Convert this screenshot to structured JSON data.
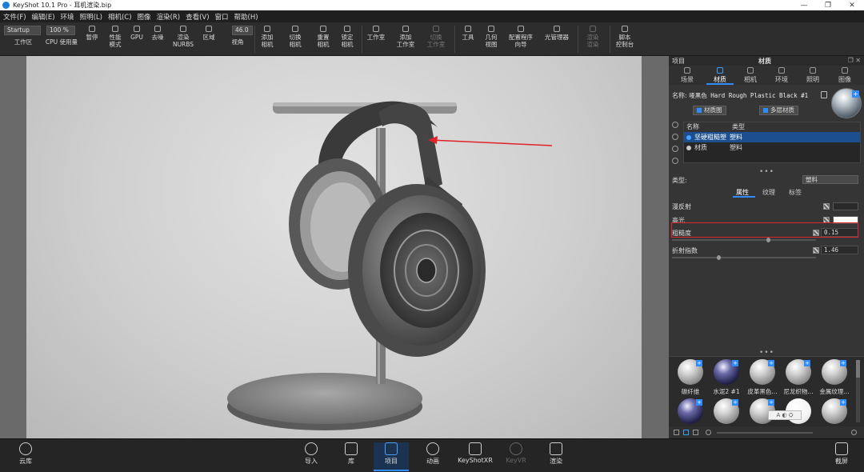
{
  "window": {
    "title": "KeyShot 10.1 Pro - 耳机渲染.bip",
    "controls": [
      "—",
      "❐",
      "✕"
    ]
  },
  "menu": [
    "文件(F)",
    "编辑(E)",
    "环境",
    "照明(L)",
    "相机(C)",
    "图像",
    "渲染(R)",
    "查看(V)",
    "窗口",
    "帮助(H)"
  ],
  "toolbar": {
    "workspace_select": "Startup",
    "zoom_value": "100 %",
    "fov_value": "46.0",
    "items": [
      {
        "label": "工作区",
        "dim": false
      },
      {
        "label": "CPU 使用量",
        "dim": false
      },
      {
        "label": "暂停",
        "dim": false
      },
      {
        "label": "性能\n模式",
        "dim": false
      },
      {
        "label": "GPU",
        "dim": false
      },
      {
        "label": "去噪",
        "dim": false
      },
      {
        "label": "渲染\nNURBS",
        "dim": false
      },
      {
        "label": "区域",
        "dim": false
      },
      {
        "label": "视角",
        "dim": false
      },
      {
        "label": "添加\n相机",
        "dim": false
      },
      {
        "label": "切换\n相机",
        "dim": false
      },
      {
        "label": "重置\n相机",
        "dim": false
      },
      {
        "label": "锁定\n相机",
        "dim": false
      },
      {
        "label": "工作室",
        "dim": false
      },
      {
        "label": "添加\n工作室",
        "dim": false
      },
      {
        "label": "切换\n工作室",
        "dim": true
      },
      {
        "label": "工具",
        "dim": false
      },
      {
        "label": "几何\n视图",
        "dim": false
      },
      {
        "label": "配置程序\n向导",
        "dim": false
      },
      {
        "label": "光管理器",
        "dim": false
      },
      {
        "label": "渲染\n渲染",
        "dim": true
      },
      {
        "label": "脚本\n控制台",
        "dim": false
      }
    ]
  },
  "panel": {
    "left_title": "项目",
    "title": "材质",
    "tabs": [
      {
        "label": "场景",
        "active": false
      },
      {
        "label": "材质",
        "active": true
      },
      {
        "label": "相机",
        "active": false
      },
      {
        "label": "环境",
        "active": false
      },
      {
        "label": "照明",
        "active": false
      },
      {
        "label": "图像",
        "active": false
      }
    ],
    "name_label": "名称:",
    "name_value": "哑黑色 Hard Rough Plastic Black #1",
    "material_graph_button": "材质图",
    "multi_layer_button": "多层材质",
    "table_headers": [
      "名称",
      "类型"
    ],
    "table_rows": [
      {
        "name": "坚硬粗糙塑",
        "type": "塑料",
        "selected": true
      },
      {
        "name": "材质",
        "type": "塑料",
        "selected": false
      }
    ],
    "type_label": "类型:",
    "type_value": "塑料",
    "subtabs": [
      {
        "label": "属性",
        "active": true
      },
      {
        "label": "纹理",
        "active": false
      },
      {
        "label": "标签",
        "active": false
      }
    ],
    "properties": {
      "diffuse_label": "漫反射",
      "diffuse_color": "#2a2a2a",
      "specular_label": "高光",
      "specular_color": "#ffffff",
      "roughness_label": "粗糙度",
      "roughness_value": "0.15",
      "ior_label": "折射指数",
      "ior_value": "1.46"
    },
    "library": [
      {
        "label": "碳纤维",
        "style": "grey"
      },
      {
        "label": "水泥2 #1",
        "style": "dark"
      },
      {
        "label": "皮革黑色...",
        "style": "grey"
      },
      {
        "label": "尼龙织物...",
        "style": "grey"
      },
      {
        "label": "金属纹理...",
        "style": "grey"
      },
      {
        "label": "",
        "style": "dark"
      },
      {
        "label": "",
        "style": "grey"
      },
      {
        "label": "",
        "style": "grey"
      },
      {
        "label": "",
        "style": "white"
      },
      {
        "label": "",
        "style": "grey"
      }
    ],
    "float_tools": "A ◐ ⛭"
  },
  "bottombar": {
    "cloud": "云库",
    "import": "导入",
    "library": "库",
    "project": "项目",
    "animation": "动画",
    "keyshotxr": "KeyShotXR",
    "keyvr": "KeyVR",
    "render": "渲染",
    "screenshot": "截屏"
  }
}
